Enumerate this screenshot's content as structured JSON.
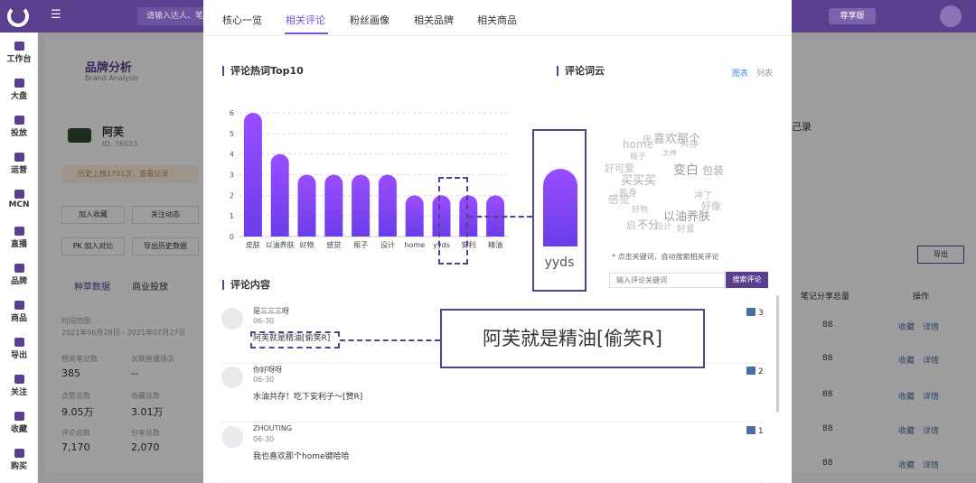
{
  "topbar": {
    "search_placeholder": "请输入达人、笔记",
    "badge": "尊享版"
  },
  "sidebar": {
    "items": [
      "工作台",
      "大盘",
      "投放",
      "运营",
      "MCN",
      "直播",
      "品牌",
      "商品",
      "导出",
      "关注",
      "收藏",
      "购买"
    ]
  },
  "background": {
    "brand_title": "品牌分析",
    "brand_subtitle": "Brand Analysis",
    "brand_name": "阿芙",
    "brand_id": "ID: 36633",
    "history_notice": "历史上榜1791次，查看记录",
    "btn_collect": "加入收藏",
    "btn_follow": "关注动态",
    "btn_compare": "PK 加入对比",
    "btn_export": "导出历史数据",
    "tab_seed": "种草数据",
    "tab_ads": "商业投放",
    "period_label": "时间范围:",
    "period_value": "2021年06月28日 - 2021年07月27日",
    "stat_labels": [
      "相关笔记数",
      "关联直播场次",
      "点赞总数",
      "收藏总数",
      "评论总数",
      "分享总数"
    ],
    "stat_values": [
      "385",
      "--",
      "9.05万",
      "3.01万",
      "7,170",
      "2,070"
    ],
    "right_record": "己录",
    "right_export": "导出",
    "right_col_share": "笔记分享总量",
    "right_col_op": "操作",
    "right_rows": [
      "88",
      "88",
      "88",
      "88",
      "88",
      "88"
    ],
    "right_links": [
      "收藏",
      "详情"
    ]
  },
  "modal": {
    "tabs": [
      "核心一览",
      "相关评论",
      "粉丝画像",
      "相关品牌",
      "相关商品"
    ],
    "active_tab": 1,
    "top10_title": "评论热词Top10",
    "wordcloud_title": "评论词云",
    "wordcloud_toggle": [
      "图表",
      "列表"
    ],
    "hint": "* 点击关键词，自动搜索相关评论",
    "search_placeholder": "输入评论关键词",
    "search_button": "搜索评论",
    "comments_title": "评论内容",
    "comments": [
      {
        "user": "是三三三呀",
        "date": "06-30",
        "text": "阿芙就是精油[偷笑R]",
        "likes": "3"
      },
      {
        "user": "你好呀呀",
        "date": "06-30",
        "text": "水油共存！吃下安利子～[赞R]",
        "likes": "2"
      },
      {
        "user": "ZHOUTING",
        "date": "06-30",
        "text": "我也喜欢那个home键哈哈",
        "likes": "1"
      }
    ],
    "callout_text": "阿芙就是精油[偷笑R]",
    "zoom_label": "yyds",
    "words": [
      "庆",
      "home",
      "喜欢那个",
      "共存",
      "好可爱",
      "瓶子",
      "太棒",
      "变白",
      "包装",
      "买买买",
      "冲了",
      "瓶身",
      "感觉",
      "好像",
      "好物",
      "以油养肤",
      "启",
      "不分",
      "设计",
      "好爱"
    ]
  },
  "chart_data": {
    "type": "bar",
    "title": "评论热词Top10",
    "categories": [
      "皮肤",
      "以油养肤",
      "好物",
      "感觉",
      "瓶子",
      "设计",
      "home",
      "yyds",
      "安利",
      "精油"
    ],
    "values": [
      6,
      4,
      3,
      3,
      3,
      3,
      2,
      2,
      2,
      2
    ],
    "ylim": [
      0,
      6
    ],
    "yticks": [
      0,
      1,
      2,
      3,
      4,
      5,
      6
    ],
    "grid": true,
    "color_top": "#9a4dff",
    "color_bottom": "#6a3de8"
  }
}
